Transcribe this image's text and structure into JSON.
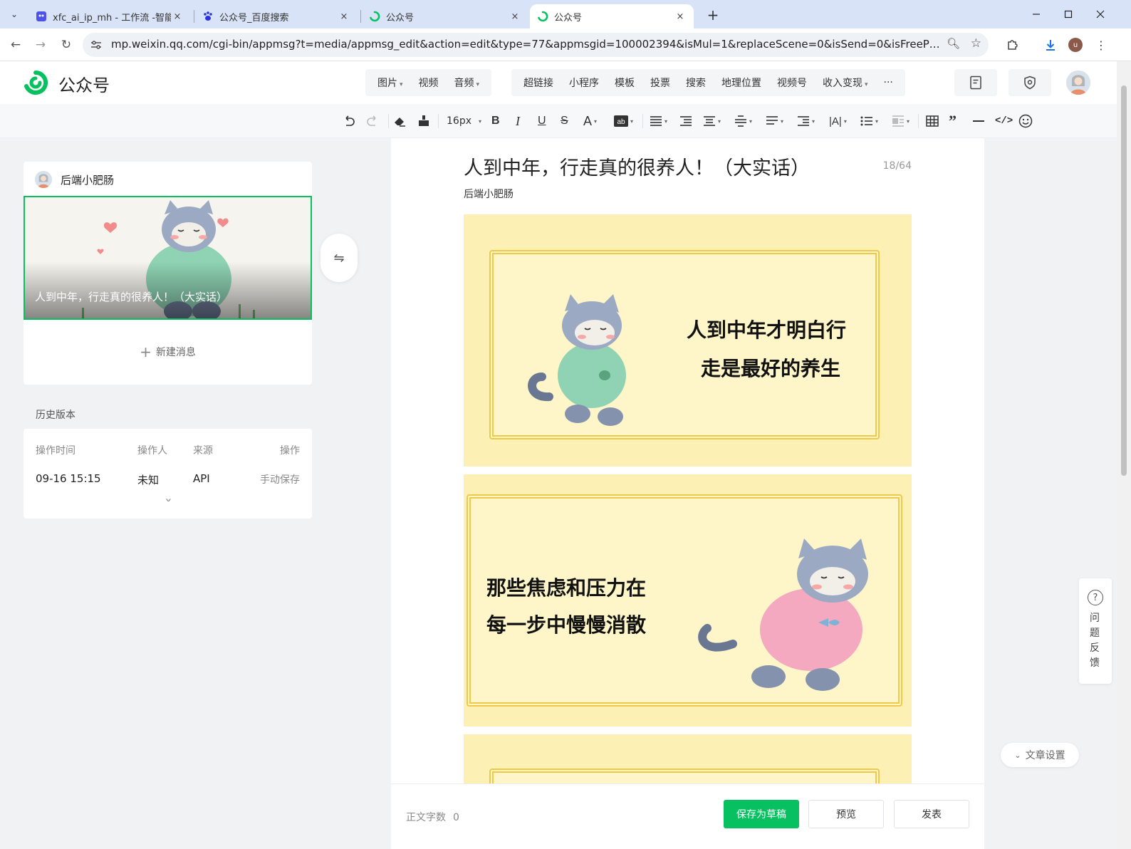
{
  "browser": {
    "tabs": [
      {
        "title": "xfc_ai_ip_mh - 工作流 -智能体",
        "icon": "coze-icon",
        "active": false
      },
      {
        "title": "公众号_百度搜索",
        "icon": "baidu-paw-icon",
        "active": false
      },
      {
        "title": "公众号",
        "icon": "weixin-mp-icon",
        "active": false
      },
      {
        "title": "公众号",
        "icon": "weixin-mp-icon",
        "active": true
      }
    ],
    "close_glyph": "×",
    "new_tab_glyph": "+",
    "url": "mp.weixin.qq.com/cgi-bin/appmsg?t=media/appmsg_edit&action=edit&type=77&appmsgid=100002394&isMul=1&replaceScene=0&isSend=0&isFreePublish=0&token=51...",
    "profile_initial": "u"
  },
  "header": {
    "brand": "公众号",
    "brand_color": "#07c160",
    "media_tools": [
      {
        "label": "图片",
        "caret": true
      },
      {
        "label": "视频",
        "caret": false
      },
      {
        "label": "音频",
        "caret": true
      }
    ],
    "insert_tools": [
      {
        "label": "超链接",
        "caret": false
      },
      {
        "label": "小程序",
        "caret": false
      },
      {
        "label": "模板",
        "caret": false
      },
      {
        "label": "投票",
        "caret": false
      },
      {
        "label": "搜索",
        "caret": false
      },
      {
        "label": "地理位置",
        "caret": false
      },
      {
        "label": "视频号",
        "caret": false
      },
      {
        "label": "收入变现",
        "caret": true
      },
      {
        "label": "···",
        "caret": false
      }
    ]
  },
  "toolbar": {
    "font_size": "16px"
  },
  "article_list": {
    "account_name": "后端小肥肠",
    "cover_title": "人到中年，行走真的很养人！（大实话）",
    "new_message": "新建消息"
  },
  "history": {
    "label": "历史版本",
    "columns": [
      "操作时间",
      "操作人",
      "来源",
      "操作"
    ],
    "rows": [
      {
        "time": "09-16 15:15",
        "operator": "未知",
        "source": "API",
        "action": "手动保存"
      }
    ]
  },
  "editor": {
    "title": "人到中年，行走真的很养人！（大实话）",
    "title_count": "18/64",
    "author": "后端小肥肠",
    "image_blocks": [
      {
        "lines": [
          "人到中年才明白行",
          "走是最好的养生"
        ],
        "hoodie_color": "#8fd3b4"
      },
      {
        "lines": [
          "那些焦虑和压力在",
          "每一步中慢慢消散"
        ],
        "hoodie_color": "#f4a9c0"
      }
    ]
  },
  "footer": {
    "word_count_label": "正文字数",
    "word_count": "0",
    "save_draft": "保存为草稿",
    "preview": "预览",
    "publish": "发表"
  },
  "float": {
    "feedback": "问题反馈",
    "feedback_glyph": "?",
    "article_settings": "文章设置"
  }
}
